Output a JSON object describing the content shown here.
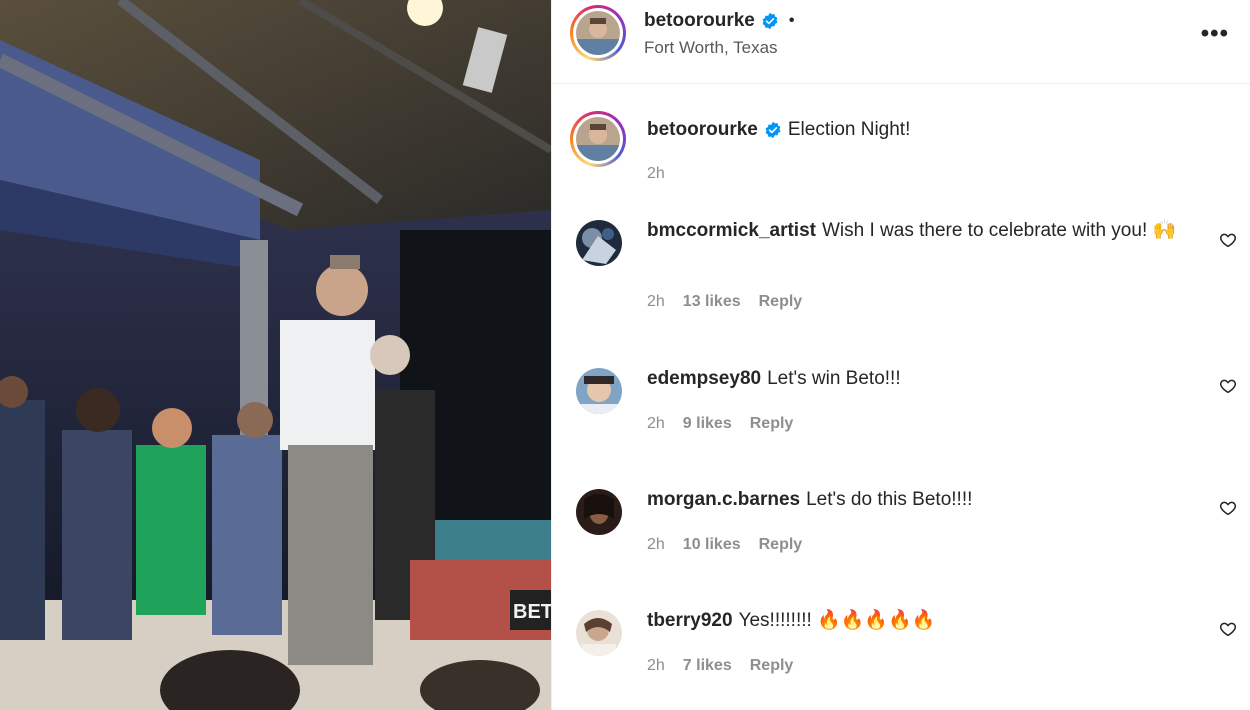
{
  "post": {
    "username": "betoorourke",
    "location": "Fort Worth, Texas",
    "separator": "•",
    "more_label": "•••"
  },
  "caption": {
    "username": "betoorourke",
    "text": "Election Night!",
    "time": "2h"
  },
  "media": {
    "sign_text": "BET"
  },
  "comments": [
    {
      "username": "bmccormick_artist",
      "text": "Wish I was there to celebrate with you! 🙌",
      "time": "2h",
      "likes": "13 likes",
      "reply": "Reply"
    },
    {
      "username": "edempsey80",
      "text": "Let's win Beto!!!",
      "time": "2h",
      "likes": "9 likes",
      "reply": "Reply"
    },
    {
      "username": "morgan.c.barnes",
      "text": "Let's do this Beto!!!!",
      "time": "2h",
      "likes": "10 likes",
      "reply": "Reply"
    },
    {
      "username": "tberry920",
      "text": "Yes!!!!!!!! 🔥🔥🔥🔥🔥",
      "time": "2h",
      "likes": "7 likes",
      "reply": "Reply"
    }
  ],
  "colors": {
    "verified": "#0095f6",
    "text": "#262626",
    "secondary": "#8e8e8e"
  }
}
